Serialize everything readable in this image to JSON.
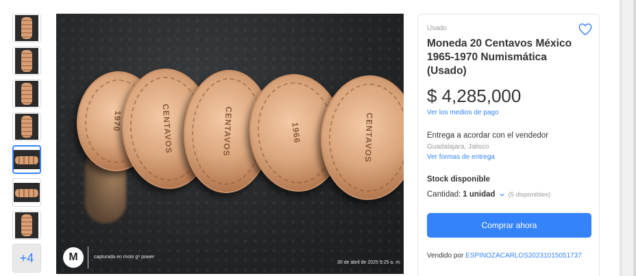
{
  "gallery": {
    "thumbnails": [
      {
        "kind": "stack"
      },
      {
        "kind": "stack"
      },
      {
        "kind": "stack"
      },
      {
        "kind": "stack"
      },
      {
        "kind": "row",
        "selected": true
      },
      {
        "kind": "row"
      },
      {
        "kind": "stack"
      }
    ],
    "more_label": "+4"
  },
  "photo": {
    "coins": [
      {
        "text": "1970"
      },
      {
        "text": "CENTAVOS"
      },
      {
        "text": "CENTAVOS"
      },
      {
        "text": "1966"
      },
      {
        "text": "CENTAVOS"
      }
    ],
    "logo_glyph": "M",
    "caption": "capturada en moto g⁸ power",
    "date": "30 de abril de 2025 9:25 a. m."
  },
  "product": {
    "condition": "Usado",
    "title": "Moneda 20 Centavos México 1965-1970 Numismática (Usado)",
    "price": "$ 4,285,000",
    "payment_link": "Ver los medios de pago",
    "delivery": "Entrega a acordar con el vendedor",
    "location": "Guadalajara, Jalisco",
    "shipping_link": "Ver formas de entrega",
    "stock": "Stock disponible",
    "quantity_label": "Cantidad:",
    "quantity_value": "1 unidad",
    "available": "(5 disponibles)",
    "buy_label": "Comprar ahora",
    "sold_by_label": "Vendido por",
    "seller_name": "ESPINOZACARLOS20231015051737"
  },
  "colors": {
    "accent": "#3483fa",
    "text": "#333333",
    "muted": "#999999"
  },
  "icons": {
    "favorite": "heart-icon",
    "quantity": "chevron-down-icon"
  }
}
